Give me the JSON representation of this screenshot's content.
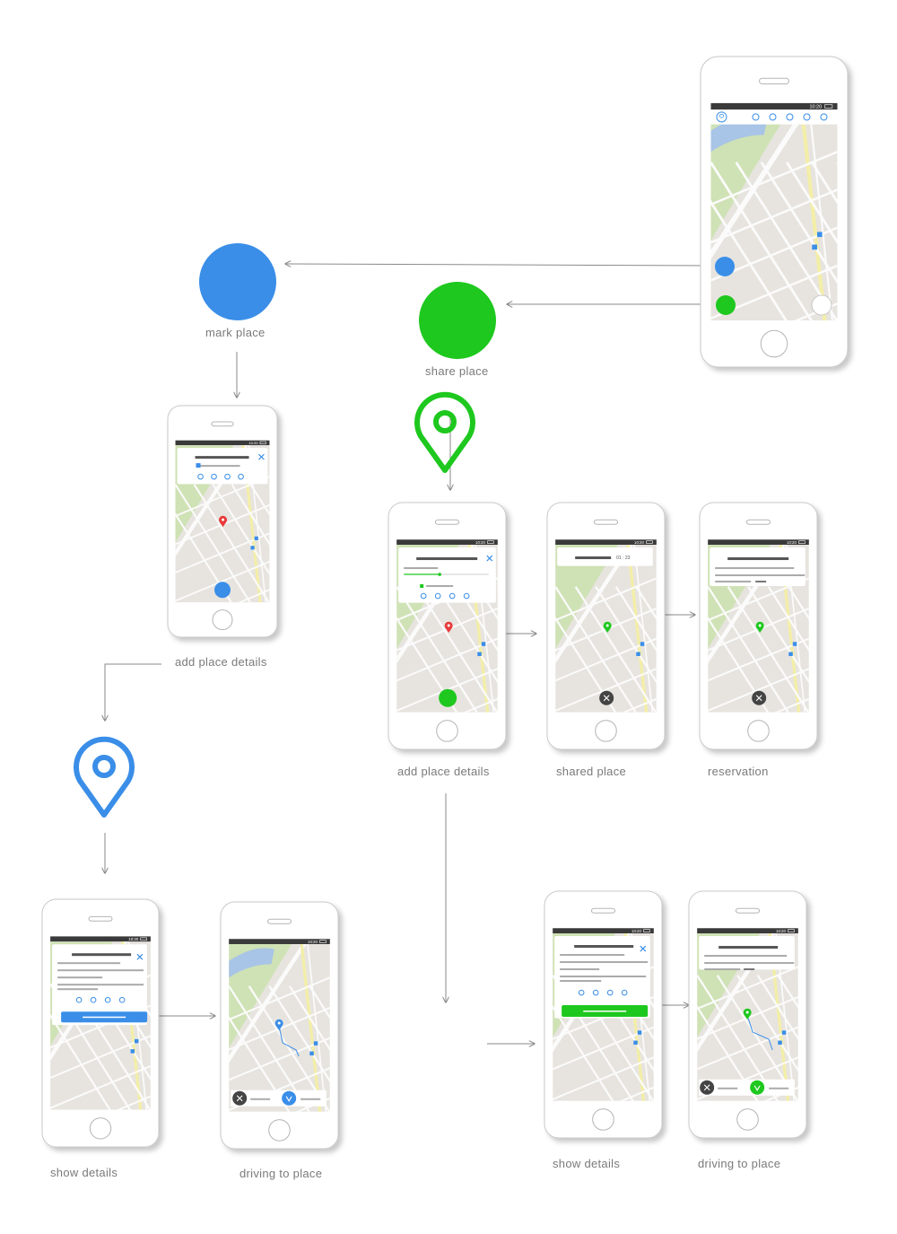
{
  "colors": {
    "blue": "#3a8ee8",
    "green": "#1ec81e",
    "arrow": "#8a8a8a",
    "phone_border": "#c9c9c9",
    "map_bg": "#e7e4df",
    "park": "#cfe2b5",
    "water": "#a8c4e6",
    "road": "#fbfbfb",
    "status_bar": "#3a3a3a"
  },
  "status_time": "10:20",
  "timer_text": "01 : 23",
  "labels": {
    "mark_place": "mark place",
    "share_place": "share place",
    "add_details_left": "add place details",
    "add_details_right": "add place details",
    "shared_place": "shared place",
    "reservation": "reservation",
    "show_details_left": "show details",
    "driving_left": "driving to place",
    "show_details_right": "show details",
    "driving_right": "driving to place"
  },
  "icons": {
    "close": "close-icon",
    "check": "check-icon",
    "pin": "location-pin-icon",
    "profile": "profile-icon"
  }
}
